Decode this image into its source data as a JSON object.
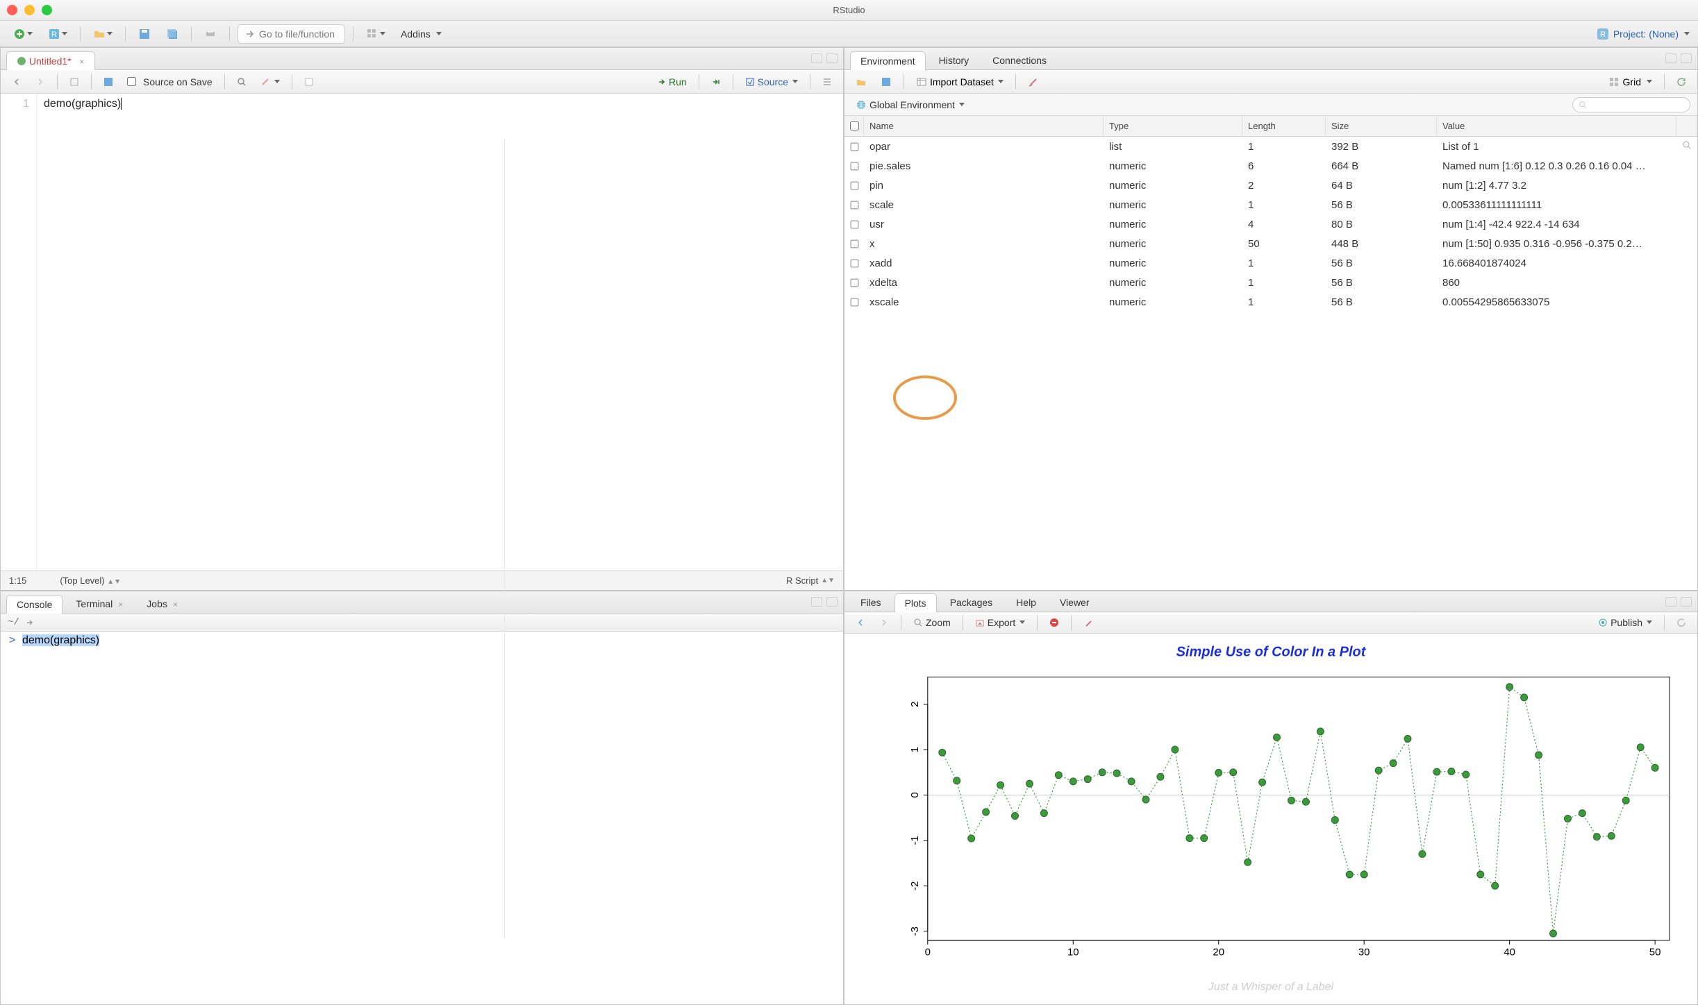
{
  "app_title": "RStudio",
  "main_toolbar": {
    "go_to_placeholder": "Go to file/function",
    "addins_label": "Addins",
    "project_label": "Project: (None)"
  },
  "source": {
    "tab_label": "Untitled1*",
    "source_on_save": "Source on Save",
    "run": "Run",
    "source_btn": "Source",
    "line_number": "1",
    "code_text": "demo(graphics)",
    "cursor_pos": "1:15",
    "scope": "(Top Level)",
    "file_type": "R Script"
  },
  "console": {
    "tabs": [
      "Console",
      "Terminal",
      "Jobs"
    ],
    "cwd": "~/",
    "prompt": ">",
    "command": "demo(graphics)"
  },
  "env": {
    "tabs": [
      "Environment",
      "History",
      "Connections"
    ],
    "import": "Import Dataset",
    "scope": "Global Environment",
    "grid_label": "Grid",
    "columns": [
      "Name",
      "Type",
      "Length",
      "Size",
      "Value"
    ],
    "rows": [
      {
        "name": "opar",
        "type": "list",
        "length": "1",
        "size": "392 B",
        "value": "List of 1"
      },
      {
        "name": "pie.sales",
        "type": "numeric",
        "length": "6",
        "size": "664 B",
        "value": "Named num [1:6] 0.12 0.3 0.26 0.16 0.04 …"
      },
      {
        "name": "pin",
        "type": "numeric",
        "length": "2",
        "size": "64 B",
        "value": "num [1:2] 4.77 3.2"
      },
      {
        "name": "scale",
        "type": "numeric",
        "length": "1",
        "size": "56 B",
        "value": "0.00533611111111111"
      },
      {
        "name": "usr",
        "type": "numeric",
        "length": "4",
        "size": "80 B",
        "value": "num [1:4] -42.4 922.4 -14 634"
      },
      {
        "name": "x",
        "type": "numeric",
        "length": "50",
        "size": "448 B",
        "value": "num [1:50] 0.935 0.316 -0.956 -0.375 0.2…"
      },
      {
        "name": "xadd",
        "type": "numeric",
        "length": "1",
        "size": "56 B",
        "value": "16.668401874024"
      },
      {
        "name": "xdelta",
        "type": "numeric",
        "length": "1",
        "size": "56 B",
        "value": "860"
      },
      {
        "name": "xscale",
        "type": "numeric",
        "length": "1",
        "size": "56 B",
        "value": "0.00554295865633075"
      }
    ]
  },
  "plots": {
    "tabs": [
      "Files",
      "Plots",
      "Packages",
      "Help",
      "Viewer"
    ],
    "zoom": "Zoom",
    "export": "Export",
    "publish": "Publish"
  },
  "chart_data": {
    "type": "line",
    "title": "Simple Use of Color In a Plot",
    "subtitle": "Just a Whisper of a Label",
    "xlabel": "",
    "ylabel": "",
    "x_ticks": [
      0,
      10,
      20,
      30,
      40,
      50
    ],
    "y_ticks": [
      -3,
      -2,
      -1,
      0,
      1,
      2
    ],
    "xlim": [
      0,
      51
    ],
    "ylim": [
      -3.2,
      2.6
    ],
    "series": [
      {
        "name": "x",
        "color": "#3c9a3c",
        "x": [
          1,
          2,
          3,
          4,
          5,
          6,
          7,
          8,
          9,
          10,
          11,
          12,
          13,
          14,
          15,
          16,
          17,
          18,
          19,
          20,
          21,
          22,
          23,
          24,
          25,
          26,
          27,
          28,
          29,
          30,
          31,
          32,
          33,
          34,
          35,
          36,
          37,
          38,
          39,
          40,
          41,
          42,
          43,
          44,
          45,
          46,
          47,
          48,
          49,
          50
        ],
        "y": [
          0.935,
          0.316,
          -0.956,
          -0.375,
          0.22,
          -0.46,
          0.25,
          -0.4,
          0.44,
          0.3,
          0.35,
          0.5,
          0.48,
          0.3,
          -0.1,
          0.4,
          1.0,
          -0.95,
          -0.95,
          0.49,
          0.5,
          -1.48,
          0.28,
          1.27,
          -0.12,
          -0.15,
          1.4,
          -0.55,
          -1.75,
          -1.75,
          0.54,
          0.7,
          1.24,
          -1.3,
          0.51,
          0.52,
          0.45,
          -1.75,
          -2.0,
          2.38,
          2.15,
          0.88,
          -3.05,
          -0.52,
          -0.4,
          -0.92,
          -0.9,
          -0.12,
          1.05,
          0.6
        ]
      }
    ]
  }
}
